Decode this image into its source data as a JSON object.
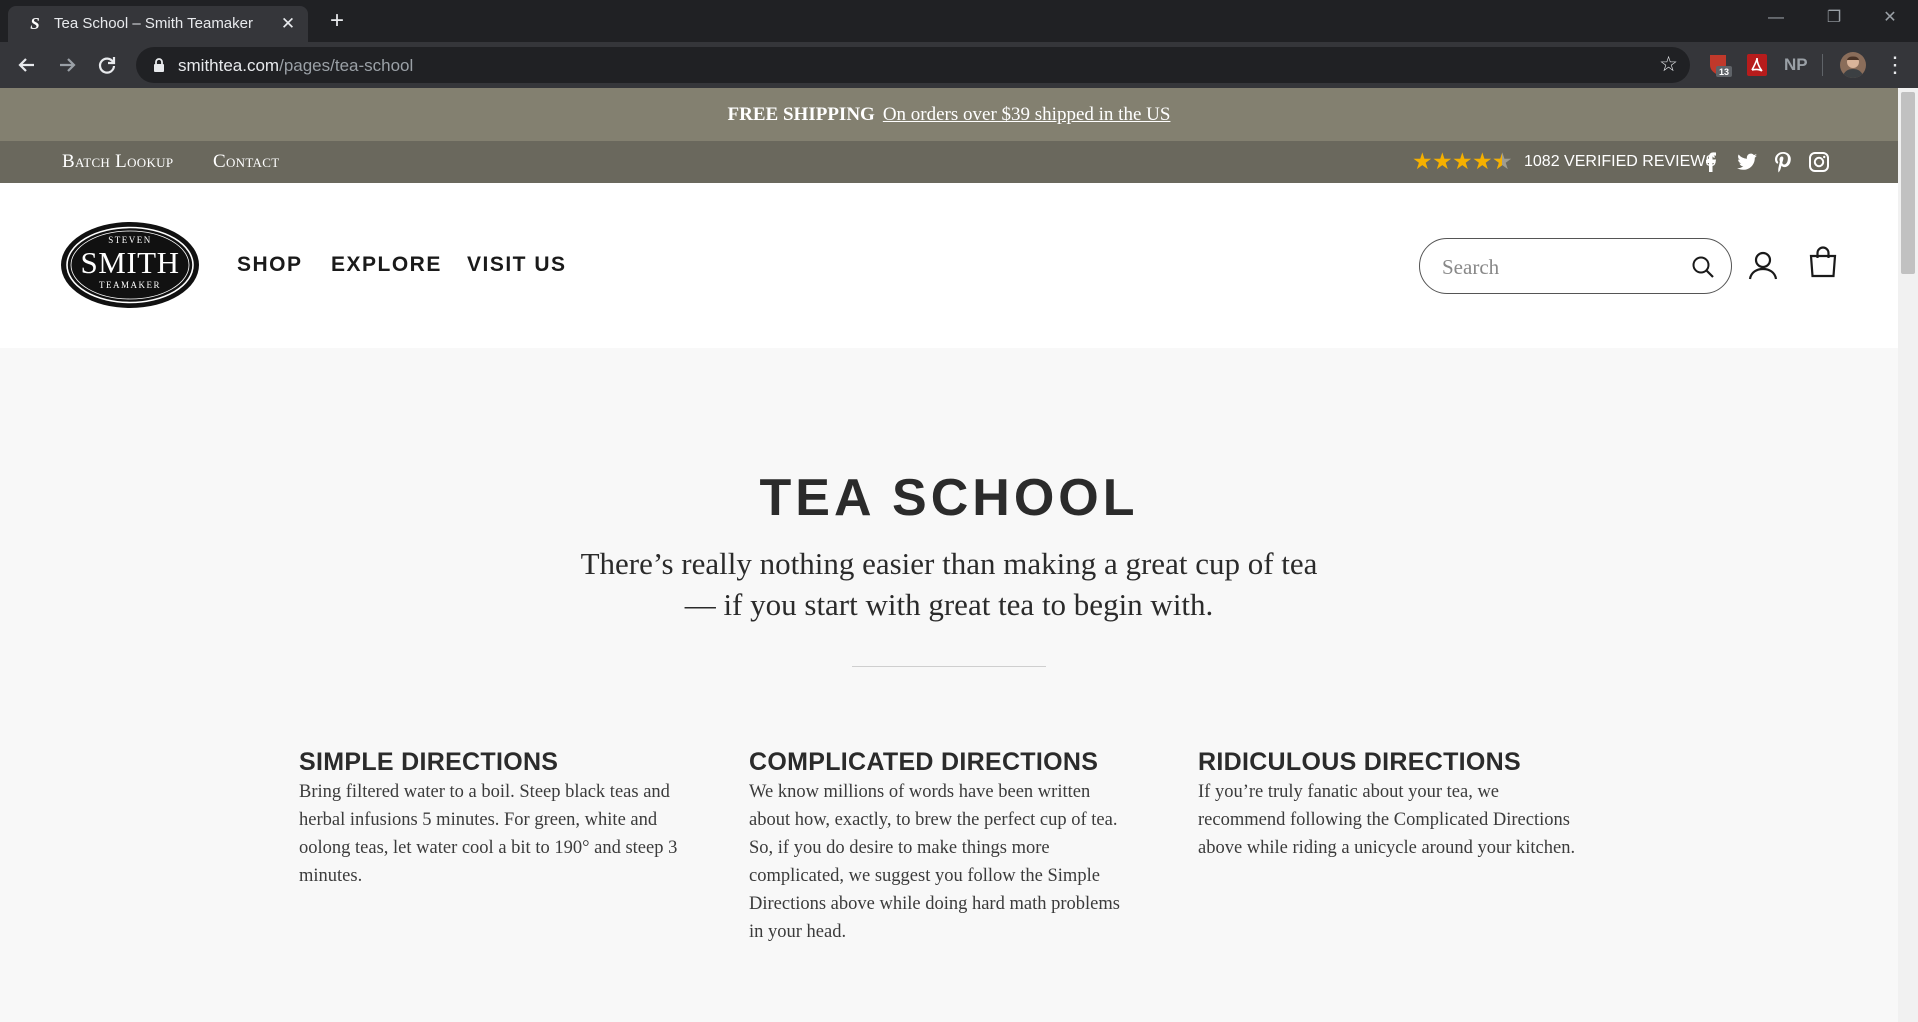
{
  "browser": {
    "tab_title": "Tea School – Smith Teamaker",
    "tab_favicon": "S",
    "url_host": "smithtea.com",
    "url_path": "/pages/tea-school",
    "extension_badge": "13",
    "extension_np": "NP"
  },
  "promo": {
    "strong": "FREE SHIPPING",
    "link": "On orders over $39 shipped in the US"
  },
  "utility": {
    "links": [
      "Batch Lookup",
      "Contact"
    ],
    "rating": 4.5,
    "reviews": "1082 VERIFIED REVIEWS",
    "social": [
      "facebook-icon",
      "twitter-icon",
      "pinterest-icon",
      "instagram-icon"
    ]
  },
  "header": {
    "logo": {
      "top": "STEVEN",
      "main": "SMITH",
      "bottom": "TEAMAKER"
    },
    "nav": [
      "SHOP",
      "EXPLORE",
      "VISIT US"
    ],
    "search_placeholder": "Search"
  },
  "main": {
    "title": "TEA SCHOOL",
    "subtitle_line1": "There’s really nothing easier than making a great cup of tea",
    "subtitle_line2": "— if you start with great tea to begin with.",
    "columns": [
      {
        "title": "SIMPLE DIRECTIONS",
        "lines": [
          "Bring filtered water to a boil. Steep black teas and",
          "herbal infusions 5 minutes. For green, white and",
          "oolong teas, let water cool a bit to 190° and steep 3",
          "minutes."
        ]
      },
      {
        "title": "COMPLICATED DIRECTIONS",
        "lines": [
          "We know millions of words have been written",
          "about how, exactly, to brew the perfect cup of tea.",
          "So, if you do desire to make things more",
          "complicated, we suggest you follow the Simple",
          "Directions above while doing hard math problems",
          "in your head."
        ]
      },
      {
        "title": "RIDICULOUS DIRECTIONS",
        "lines": [
          "If you’re truly fanatic about your tea, we",
          "recommend following the Complicated Directions",
          "above while riding a unicycle around your kitchen."
        ]
      }
    ]
  }
}
